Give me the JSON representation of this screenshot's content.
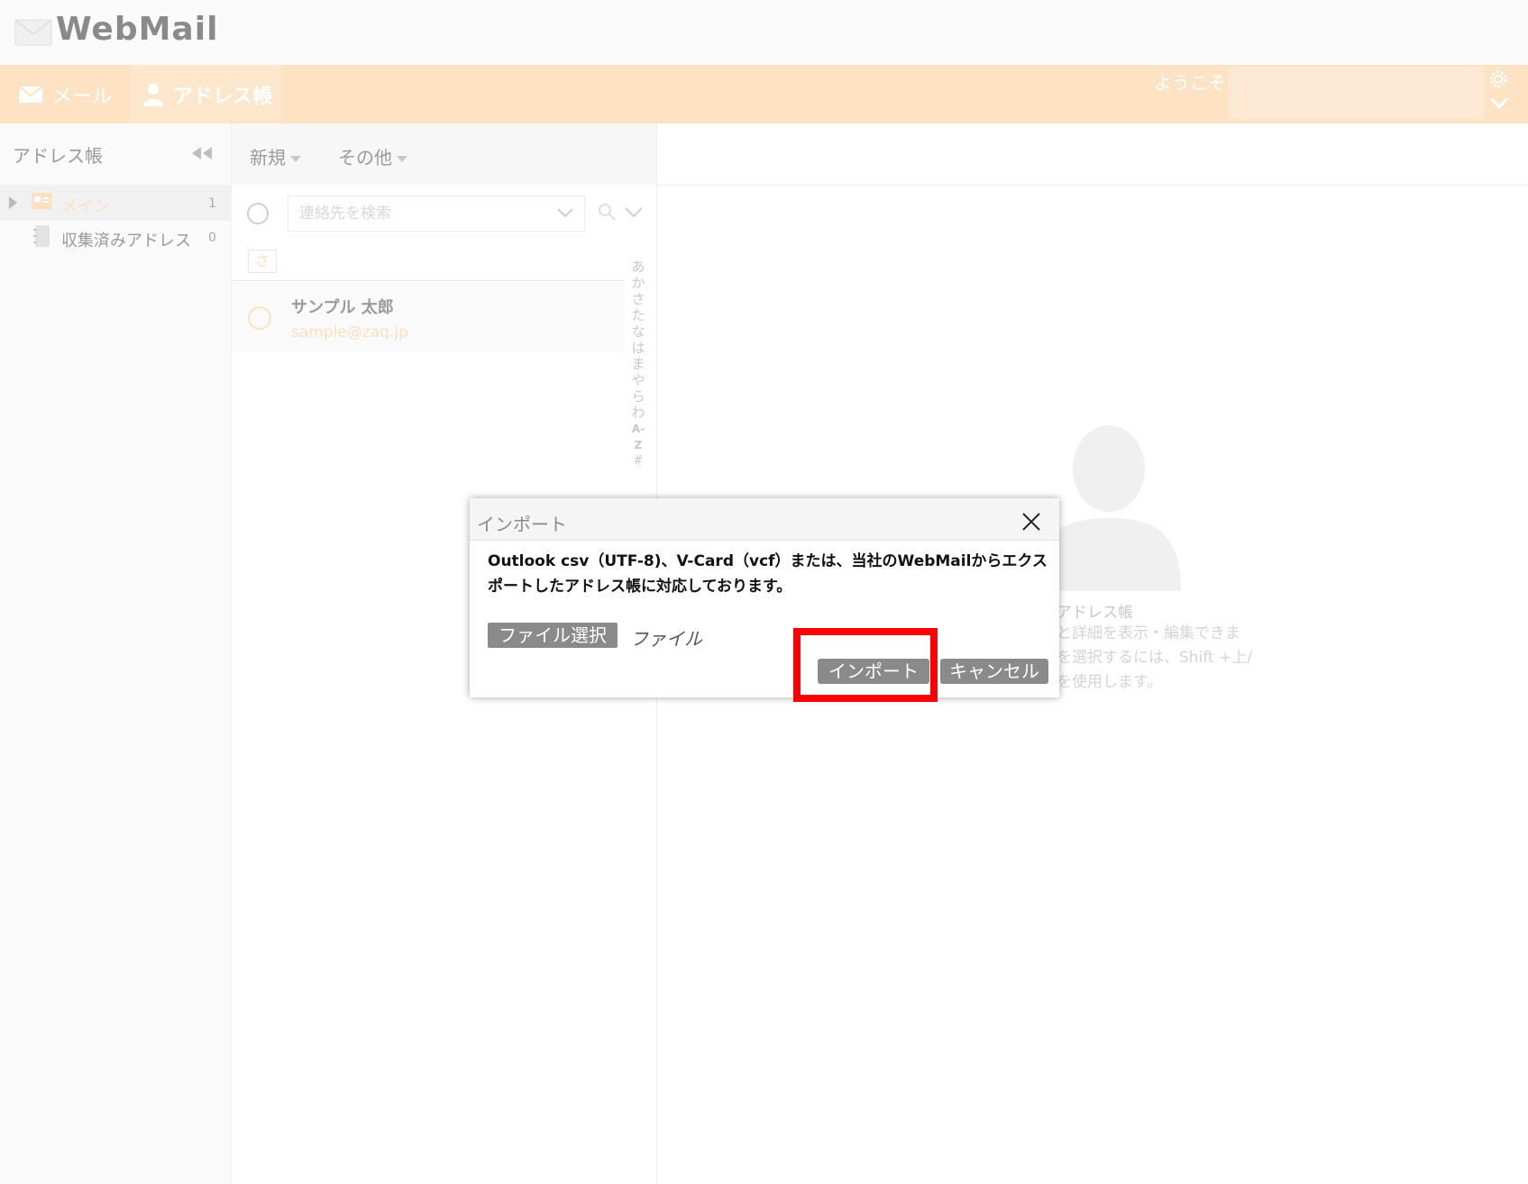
{
  "app": {
    "logo_text": "WebMail"
  },
  "nav": {
    "tabs": [
      {
        "label": "メール",
        "icon": "envelope-icon"
      },
      {
        "label": "アドレス帳",
        "icon": "person-icon"
      }
    ],
    "welcome": "ようこそ"
  },
  "sidebar": {
    "title": "アドレス帳",
    "groups": [
      {
        "label": "メイン",
        "count": "1"
      },
      {
        "label": "収集済みアドレス",
        "count": "0"
      }
    ]
  },
  "list": {
    "new_label": "新規",
    "other_label": "その他",
    "search_placeholder": "連絡先を検索",
    "letter": "さ",
    "contacts": [
      {
        "name": "サンプル 太郎",
        "email": "sample@zaq.jp"
      }
    ],
    "alpha_index": [
      "あ",
      "か",
      "さ",
      "た",
      "な",
      "は",
      "ま",
      "や",
      "ら",
      "わ",
      "A-Z",
      "#"
    ]
  },
  "detail": {
    "placeholder_title": "アドレス帳",
    "placeholder_lines": [
      "と詳細を表示・編集できま",
      "を選択するには、Shift +上/",
      "を使用します。"
    ]
  },
  "modal": {
    "title": "インポート",
    "description": "Outlook csv（UTF-8)、V-Card（vcf）または、当社のWebMailからエクスポートしたアドレス帳に対応しております。",
    "file_select_label": "ファイル選択",
    "file_label": "ファイル",
    "import_label": "インポート",
    "cancel_label": "キャンセル"
  },
  "colors": {
    "accent": "#fde3c4",
    "highlight": "#ff0000",
    "button_gray": "#8a8a8a"
  }
}
